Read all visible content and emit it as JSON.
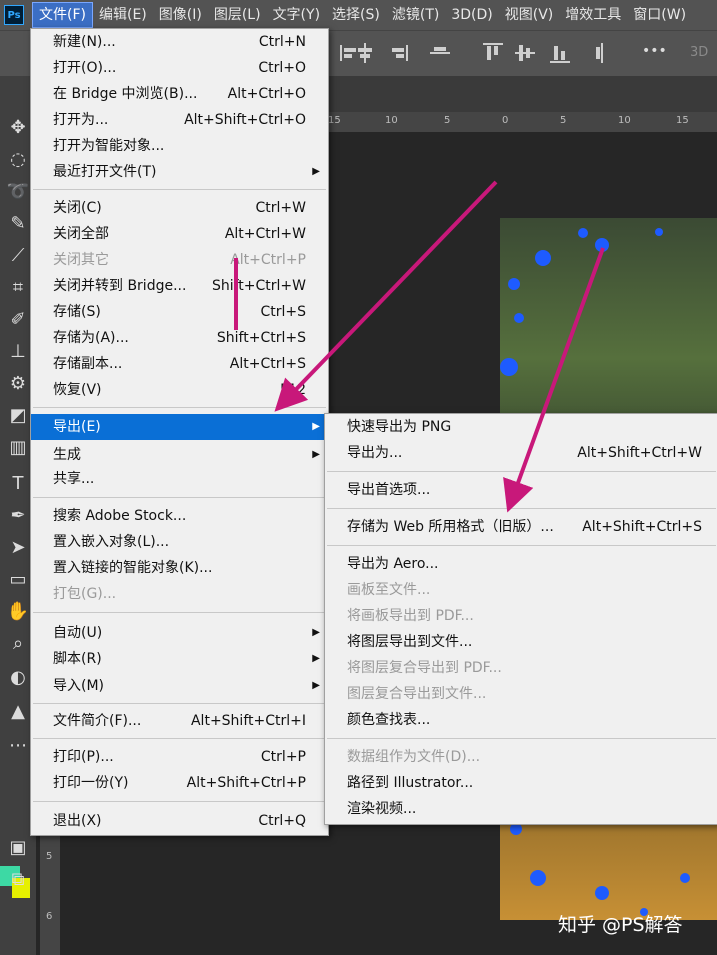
{
  "app": {
    "logo": "Ps"
  },
  "menubar": {
    "items": [
      "文件(F)",
      "编辑(E)",
      "图像(I)",
      "图层(L)",
      "文字(Y)",
      "选择(S)",
      "滤镜(T)",
      "3D(D)",
      "视图(V)",
      "增效工具",
      "窗口(W)"
    ],
    "active_index": 0
  },
  "options_bar": {
    "more_label": "•••",
    "mode_label": "3D"
  },
  "ruler": {
    "h_labels": [
      "15",
      "10",
      "5",
      "0",
      "5",
      "10",
      "15"
    ],
    "v_labels": [
      "5",
      "6"
    ]
  },
  "file_menu": {
    "items": [
      {
        "label": "新建(N)...",
        "shortcut": "Ctrl+N",
        "disabled": false
      },
      {
        "label": "打开(O)...",
        "shortcut": "Ctrl+O",
        "disabled": false
      },
      {
        "label": "在 Bridge 中浏览(B)...",
        "shortcut": "Alt+Ctrl+O",
        "disabled": false
      },
      {
        "label": "打开为...",
        "shortcut": "Alt+Shift+Ctrl+O",
        "disabled": false
      },
      {
        "label": "打开为智能对象...",
        "shortcut": "",
        "disabled": false
      },
      {
        "label": "最近打开文件(T)",
        "shortcut": "",
        "disabled": false,
        "submenu": true
      },
      {
        "label": "关闭(C)",
        "shortcut": "Ctrl+W",
        "disabled": false
      },
      {
        "label": "关闭全部",
        "shortcut": "Alt+Ctrl+W",
        "disabled": false
      },
      {
        "label": "关闭其它",
        "shortcut": "Alt+Ctrl+P",
        "disabled": true
      },
      {
        "label": "关闭并转到 Bridge...",
        "shortcut": "Shift+Ctrl+W",
        "disabled": false
      },
      {
        "label": "存储(S)",
        "shortcut": "Ctrl+S",
        "disabled": false
      },
      {
        "label": "存储为(A)...",
        "shortcut": "Shift+Ctrl+S",
        "disabled": false
      },
      {
        "label": "存储副本...",
        "shortcut": "Alt+Ctrl+S",
        "disabled": false
      },
      {
        "label": "恢复(V)",
        "shortcut": "F12",
        "disabled": false
      },
      {
        "label": "导出(E)",
        "shortcut": "",
        "disabled": false,
        "submenu": true,
        "highlighted": true
      },
      {
        "label": "生成",
        "shortcut": "",
        "disabled": false,
        "submenu": true
      },
      {
        "label": "共享...",
        "shortcut": "",
        "disabled": false
      },
      {
        "label": "搜索 Adobe Stock...",
        "shortcut": "",
        "disabled": false
      },
      {
        "label": "置入嵌入对象(L)...",
        "shortcut": "",
        "disabled": false
      },
      {
        "label": "置入链接的智能对象(K)...",
        "shortcut": "",
        "disabled": false
      },
      {
        "label": "打包(G)...",
        "shortcut": "",
        "disabled": true
      },
      {
        "label": "自动(U)",
        "shortcut": "",
        "disabled": false,
        "submenu": true
      },
      {
        "label": "脚本(R)",
        "shortcut": "",
        "disabled": false,
        "submenu": true
      },
      {
        "label": "导入(M)",
        "shortcut": "",
        "disabled": false,
        "submenu": true
      },
      {
        "label": "文件简介(F)...",
        "shortcut": "Alt+Shift+Ctrl+I",
        "disabled": false
      },
      {
        "label": "打印(P)...",
        "shortcut": "Ctrl+P",
        "disabled": false
      },
      {
        "label": "打印一份(Y)",
        "shortcut": "Alt+Shift+Ctrl+P",
        "disabled": false
      },
      {
        "label": "退出(X)",
        "shortcut": "Ctrl+Q",
        "disabled": false
      }
    ]
  },
  "export_submenu": {
    "items": [
      {
        "label": "快速导出为 PNG",
        "shortcut": "",
        "disabled": false
      },
      {
        "label": "导出为...",
        "shortcut": "Alt+Shift+Ctrl+W",
        "disabled": false
      },
      {
        "label": "导出首选项...",
        "shortcut": "",
        "disabled": false
      },
      {
        "label": "存储为 Web 所用格式（旧版）...",
        "shortcut": "Alt+Shift+Ctrl+S",
        "disabled": false
      },
      {
        "label": "导出为 Aero...",
        "shortcut": "",
        "disabled": false
      },
      {
        "label": "画板至文件...",
        "shortcut": "",
        "disabled": true
      },
      {
        "label": "将画板导出到 PDF...",
        "shortcut": "",
        "disabled": true
      },
      {
        "label": "将图层导出到文件...",
        "shortcut": "",
        "disabled": false
      },
      {
        "label": "将图层复合导出到 PDF...",
        "shortcut": "",
        "disabled": true
      },
      {
        "label": "图层复合导出到文件...",
        "shortcut": "",
        "disabled": true
      },
      {
        "label": "颜色查找表...",
        "shortcut": "",
        "disabled": false
      },
      {
        "label": "数据组作为文件(D)...",
        "shortcut": "",
        "disabled": true
      },
      {
        "label": "路径到 Illustrator...",
        "shortcut": "",
        "disabled": false
      },
      {
        "label": "渲染视频...",
        "shortcut": "",
        "disabled": false
      }
    ]
  },
  "watermark": "知乎 @PS解答",
  "colors": {
    "highlight": "#0a6fd6",
    "arrow": "#c8187a",
    "menu_bg": "#f0f0f0",
    "dots": "#1e5bff"
  }
}
